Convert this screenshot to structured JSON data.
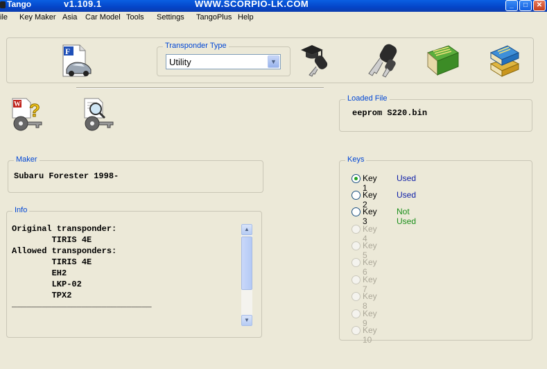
{
  "window": {
    "app_name": "Tango",
    "version": "v1.109.1",
    "website": "WWW.SCORPIO-LK.COM"
  },
  "menu": [
    "ile",
    "Key Maker",
    "Asia",
    "Car Model",
    "Tools",
    "Settings",
    "TangoPlus",
    "Help"
  ],
  "toolbar": {
    "transponder_type_label": "Transponder Type",
    "transponder_type_value": "Utility",
    "file_icon_letter": "F"
  },
  "loaded_file": {
    "label": "Loaded File",
    "value": "eeprom S220.bin"
  },
  "maker": {
    "label": "Maker",
    "value": "Subaru Forester 1998-"
  },
  "info": {
    "label": "Info",
    "lines": [
      "Original transponder:",
      "        TIRIS 4E",
      "Allowed transponders:",
      "        TIRIS 4E",
      "        EH2",
      "        LKP-02",
      "        TPX2",
      "____________________________"
    ]
  },
  "keys": {
    "label": "Keys",
    "items": [
      {
        "label": "Key 1",
        "status": "Used",
        "enabled": true,
        "checked": true
      },
      {
        "label": "Key 2",
        "status": "Used",
        "enabled": true,
        "checked": false
      },
      {
        "label": "Key 3",
        "status": "Not Used",
        "enabled": true,
        "checked": false
      },
      {
        "label": "Key 4",
        "status": "",
        "enabled": false,
        "checked": false
      },
      {
        "label": "Key 5",
        "status": "",
        "enabled": false,
        "checked": false
      },
      {
        "label": "Key 6",
        "status": "",
        "enabled": false,
        "checked": false
      },
      {
        "label": "Key 7",
        "status": "",
        "enabled": false,
        "checked": false
      },
      {
        "label": "Key 8",
        "status": "",
        "enabled": false,
        "checked": false
      },
      {
        "label": "Key 9",
        "status": "",
        "enabled": false,
        "checked": false
      },
      {
        "label": "Key 10",
        "status": "",
        "enabled": false,
        "checked": false
      }
    ]
  },
  "colors": {
    "used": "#0B1CA8",
    "not_used": "#1A8F1A",
    "legend": "#0046D5"
  }
}
